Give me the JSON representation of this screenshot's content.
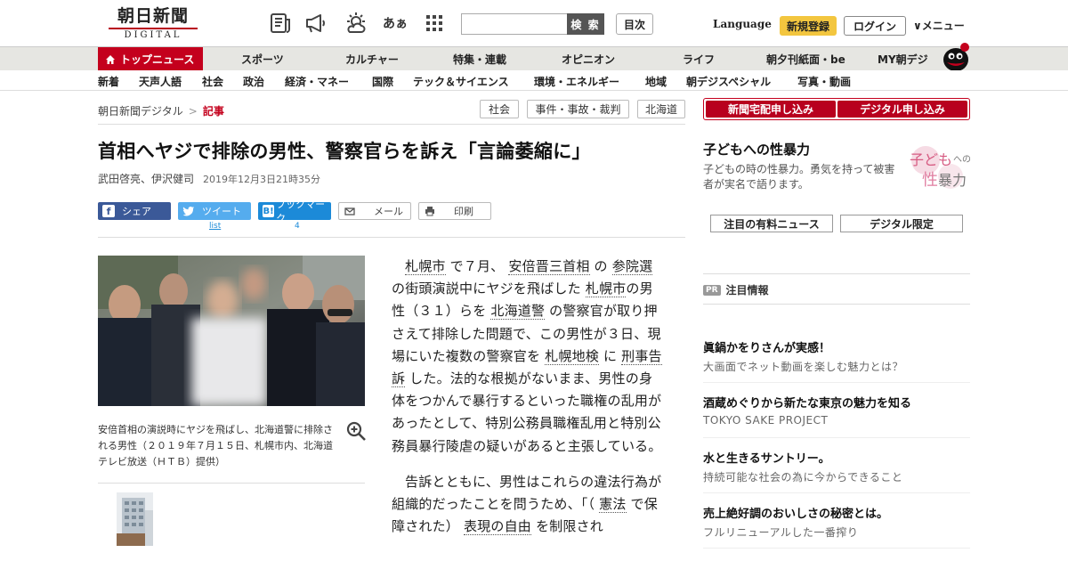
{
  "header": {
    "logo_jp": "朝日新聞",
    "logo_en": "DIGITAL",
    "search_button": "検 索",
    "search_placeholder": "",
    "toc_button": "目次",
    "language": "Language",
    "register": "新規登録",
    "login": "ログイン",
    "menu": "∨メニュー",
    "icons": [
      "newspaper-icon",
      "megaphone-icon",
      "weather-icon",
      "font-size-icon",
      "apps-grid-icon"
    ],
    "font_size_glyph": "あぁ"
  },
  "primary_nav": [
    {
      "label": "トップニュース",
      "active": true
    },
    {
      "label": "スポーツ"
    },
    {
      "label": "カルチャー"
    },
    {
      "label": "特集・連載"
    },
    {
      "label": "オピニオン"
    },
    {
      "label": "ライフ"
    },
    {
      "label": "朝夕刊紙面・be"
    },
    {
      "label": "MY朝デジ"
    }
  ],
  "secondary_nav": [
    "新着",
    "天声人語",
    "社会",
    "政治",
    "経済・マネー",
    "国際",
    "テック＆サイエンス",
    "環境・エネルギー",
    "地域",
    "朝デジスペシャル",
    "写真・動画"
  ],
  "breadcrumb": {
    "root": "朝日新聞デジタル",
    "sep": ">",
    "current": "記事"
  },
  "tags": [
    "社会",
    "事件・事故・裁判",
    "北海道"
  ],
  "article": {
    "headline": "首相へヤジで排除の男性、警察官らを訴え「言論萎縮に」",
    "authors": "武田啓亮、伊沢健司",
    "date": "2019年12月3日21時35分",
    "share": {
      "facebook": "シェア",
      "twitter": "ツイート",
      "hatena": "ブックマーク",
      "mail": "メール",
      "print": "印刷",
      "twitter_count": "list",
      "hatena_count": "4"
    },
    "caption": "安倍首相の演説時にヤジを飛ばし、北海道警に排除される男性（２０１９年７月１５日、札幌市内、北海道テレビ放送（ＨＴＢ）提供）",
    "para1": [
      {
        "t": "札幌市",
        "link": true
      },
      {
        "t": " で７月、 "
      },
      {
        "t": "安倍晋三首相",
        "link": true
      },
      {
        "t": " の "
      },
      {
        "t": "参院選",
        "link": true
      },
      {
        "t": " の街頭演説中にヤジを飛ばした "
      },
      {
        "t": "札幌市",
        "link": true
      },
      {
        "t": "の男性（３１）らを "
      },
      {
        "t": "北海道警",
        "link": true
      },
      {
        "t": " の警察官が取り押さえて排除した問題で、この男性が３日、現場にいた複数の警察官を "
      },
      {
        "t": "札幌地検",
        "link": true
      },
      {
        "t": " に "
      },
      {
        "t": "刑事告訴",
        "link": true
      },
      {
        "t": " した。法的な根拠がないまま、男性の身体をつかんで暴行するといった職権の乱用があったとして、特別公務員職権乱用と特別公務員暴行陵虐の疑いがあると主張している。"
      }
    ],
    "para2": [
      {
        "t": "告訴とともに、男性はこれらの違法行為が組織的だったことを問うため、「（ "
      },
      {
        "t": "憲法",
        "link": true
      },
      {
        "t": " で保障された） "
      },
      {
        "t": "表現の自由",
        "link": true
      },
      {
        "t": " を制限され"
      }
    ]
  },
  "sidebar": {
    "order_home": "新聞宅配申し込み",
    "order_digital": "デジタル申し込み",
    "feature_title": "子どもへの性暴力",
    "feature_desc": "子どもの時の性暴力。勇気を持って被害者が実名で語ります。",
    "feature_logo": [
      "子ども",
      "への",
      "性",
      "暴力"
    ],
    "btn_paid": "注目の有料ニュース",
    "btn_digital": "デジタル限定",
    "pr_badge": "PR",
    "pr_head": "注目情報",
    "pr_items": [
      {
        "title": "眞鍋かをりさんが実感！",
        "sub": "大画面でネット動画を楽しむ魅力とは？"
      },
      {
        "title": "酒蔵めぐりから新たな東京の魅力を知る",
        "sub": "TOKYO SAKE PROJECT"
      },
      {
        "title": "水と生きるサントリー。",
        "sub": "持続可能な社会の為に今からできること"
      },
      {
        "title": "売上絶好調のおいしさの秘密とは。",
        "sub": "フルリニューアルした一番搾り"
      }
    ]
  },
  "colors": {
    "brand_red": "#c4001d",
    "nav_bg": "#e6e6e2",
    "register_yellow": "#f3c63f"
  }
}
